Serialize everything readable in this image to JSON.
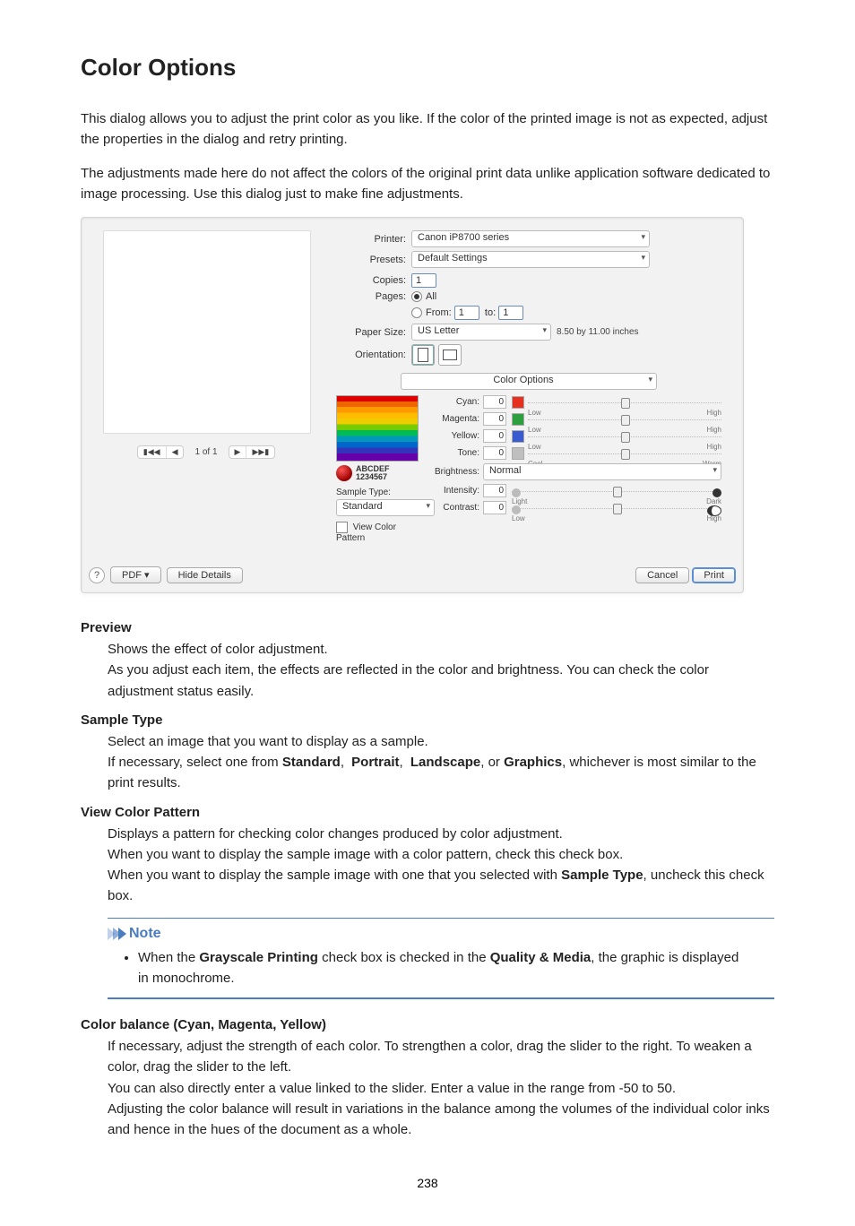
{
  "heading": "Color Options",
  "intro1": "This dialog allows you to adjust the print color as you like. If the color of the printed image is not as expected, adjust the properties in the dialog and retry printing.",
  "intro2": "The adjustments made here do not affect the colors of the original print data unlike application software dedicated to image processing. Use this dialog just to make fine adjustments.",
  "dialog": {
    "printer_label": "Printer:",
    "printer_value": "Canon iP8700 series",
    "presets_label": "Presets:",
    "presets_value": "Default Settings",
    "copies_label": "Copies:",
    "copies_value": "1",
    "pages_label": "Pages:",
    "pages_all": "All",
    "pages_from": "From:",
    "pages_from_value": "1",
    "pages_to": "to:",
    "pages_to_value": "1",
    "papersize_label": "Paper Size:",
    "papersize_value": "US Letter",
    "papersize_dim": "8.50 by 11.00 inches",
    "orientation_label": "Orientation:",
    "panel_label": "Color Options",
    "preview_nav": {
      "first": "▮◀◀",
      "prev": "◀",
      "counter": "1 of 1",
      "next": "▶",
      "last": "▶▶▮"
    },
    "sliders": {
      "cyan": {
        "label": "Cyan:",
        "value": "0",
        "left": "Low",
        "right": "High",
        "swatch": "#e63020"
      },
      "magenta": {
        "label": "Magenta:",
        "value": "0",
        "left": "Low",
        "right": "High",
        "swatch": "#2e9f3e"
      },
      "yellow": {
        "label": "Yellow:",
        "value": "0",
        "left": "Low",
        "right": "High",
        "swatch": "#3a5bd0"
      },
      "tone": {
        "label": "Tone:",
        "value": "0",
        "left": "Cool",
        "right": "Warm",
        "swatch": "#bfbfbf"
      },
      "brightness_label": "Brightness:",
      "brightness_value": "Normal",
      "intensity": {
        "label": "Intensity:",
        "value": "0",
        "left": "Light",
        "right": "Dark"
      },
      "contrast": {
        "label": "Contrast:",
        "value": "0",
        "left": "Low",
        "right": "High"
      }
    },
    "sample": {
      "text1": "ABCDEF",
      "text2": "1234567",
      "sample_type_label": "Sample Type:",
      "sample_type_value": "Standard",
      "view_pattern_label": "View Color Pattern"
    },
    "footer": {
      "help": "?",
      "pdf": "PDF ▾",
      "hide": "Hide Details",
      "cancel": "Cancel",
      "print": "Print"
    }
  },
  "defs": {
    "preview": {
      "term": "Preview",
      "p1": "Shows the effect of color adjustment.",
      "p2": "As you adjust each item, the effects are reflected in the color and brightness. You can check the color adjustment status easily."
    },
    "sample_type": {
      "term": "Sample Type",
      "p1": "Select an image that you want to display as a sample.",
      "p2a": "If necessary, select one from ",
      "opt1": "Standard",
      "sep": ",",
      "opt2": "Portrait",
      "opt3": "Landscape",
      "or": ", or ",
      "opt4": "Graphics",
      "p2b": ", whichever is most similar to the print results."
    },
    "view_pattern": {
      "term": "View Color Pattern",
      "p1": "Displays a pattern for checking color changes produced by color adjustment.",
      "p2": "When you want to display the sample image with a color pattern, check this check box.",
      "p3a": "When you want to display the sample image with one that you selected with ",
      "p3b_bold": "Sample Type",
      "p3c": ", uncheck this check box."
    },
    "note": {
      "head": "Note",
      "li_a": "When the ",
      "li_bold1": "Grayscale Printing",
      "li_b": " check box is checked in the ",
      "li_bold2": "Quality & Media",
      "li_c": ", the graphic is displayed in monochrome."
    },
    "color_balance": {
      "term": "Color balance (Cyan, Magenta, Yellow)",
      "p1": "If necessary, adjust the strength of each color. To strengthen a color, drag the slider to the right. To weaken a color, drag the slider to the left.",
      "p2": "You can also directly enter a value linked to the slider. Enter a value in the range from -50 to 50.",
      "p3": "Adjusting the color balance will result in variations in the balance among the volumes of the individual color inks and hence in the hues of the document as a whole."
    }
  },
  "page_number": "238"
}
